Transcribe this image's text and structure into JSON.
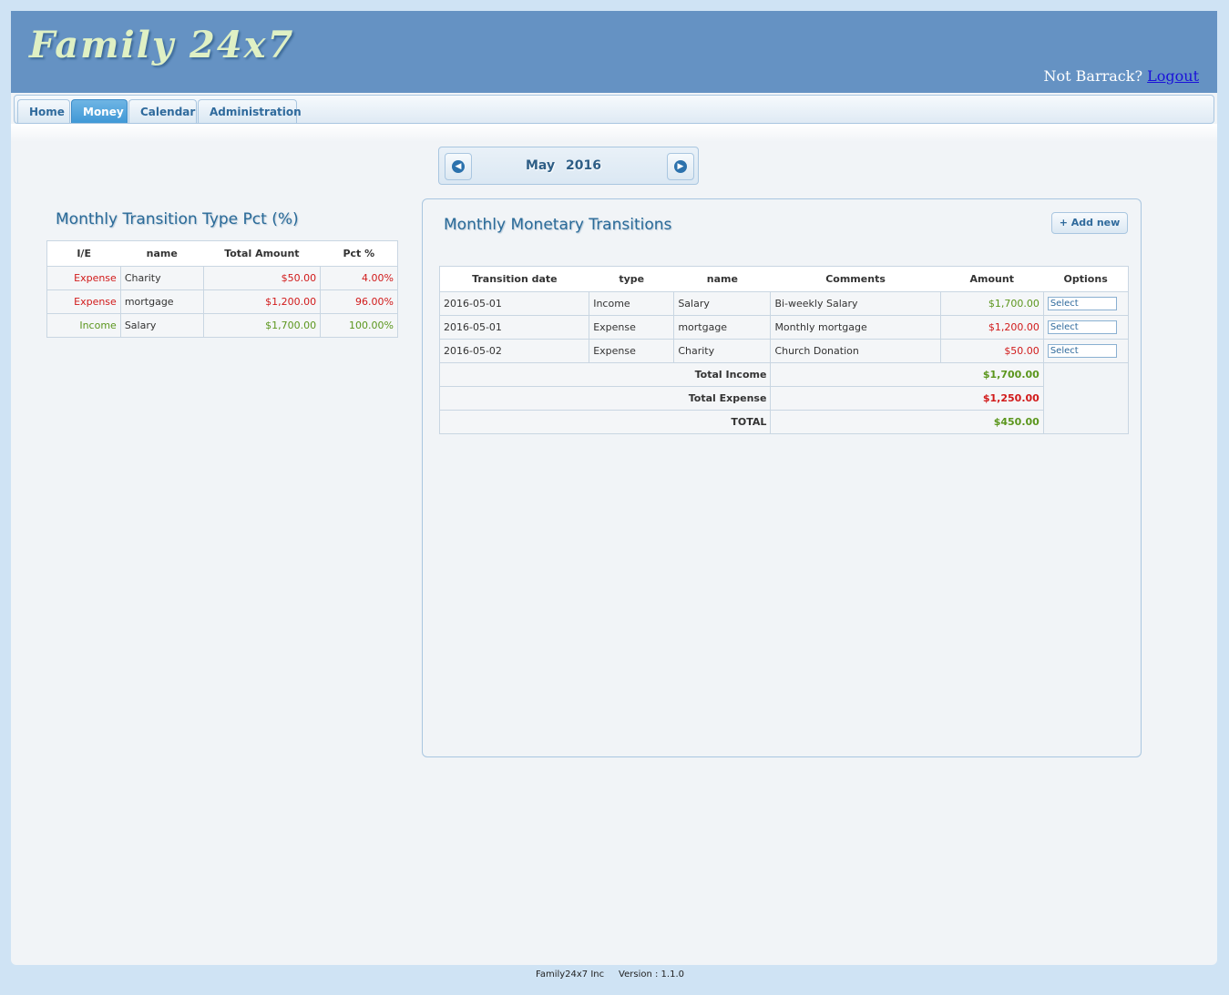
{
  "header": {
    "logo": "Family 24x7",
    "user_prompt": "Not Barrack?",
    "logout": "Logout"
  },
  "tabs": [
    {
      "label": "Home"
    },
    {
      "label": "Money"
    },
    {
      "label": "Calendar"
    },
    {
      "label": "Administration"
    }
  ],
  "month_nav": {
    "month": "May",
    "year": "2016",
    "prev_icon": "chevron-left-icon",
    "next_icon": "chevron-right-icon"
  },
  "pct_panel": {
    "title": "Monthly Transition Type Pct (%)",
    "headers": [
      "I/E",
      "name",
      "Total Amount",
      "Pct %"
    ],
    "rows": [
      {
        "ie": "Expense",
        "name": "Charity",
        "amount": "$50.00",
        "pct": "4.00%"
      },
      {
        "ie": "Expense",
        "name": "mortgage",
        "amount": "$1,200.00",
        "pct": "96.00%"
      },
      {
        "ie": "Income",
        "name": "Salary",
        "amount": "$1,700.00",
        "pct": "100.00%"
      }
    ]
  },
  "trans_panel": {
    "title": "Monthly Monetary Transitions",
    "add_button": "+ Add new",
    "headers": [
      "Transition date",
      "type",
      "name",
      "Comments",
      "Amount",
      "Options"
    ],
    "rows": [
      {
        "date": "2016-05-01",
        "type": "Income",
        "name": "Salary",
        "comments": "Bi-weekly Salary",
        "amount": "$1,700.00",
        "option": "Select"
      },
      {
        "date": "2016-05-01",
        "type": "Expense",
        "name": "mortgage",
        "comments": "Monthly mortgage",
        "amount": "$1,200.00",
        "option": "Select"
      },
      {
        "date": "2016-05-02",
        "type": "Expense",
        "name": "Charity",
        "comments": "Church Donation",
        "amount": "$50.00",
        "option": "Select"
      }
    ],
    "totals": {
      "income_label": "Total Income",
      "income_value": "$1,700.00",
      "expense_label": "Total Expense",
      "expense_value": "$1,250.00",
      "total_label": "TOTAL",
      "total_value": "$450.00"
    }
  },
  "footer": {
    "company": "Family24x7 Inc",
    "version": "Version : 1.1.0"
  },
  "colors": {
    "header_bg": "#6592c3",
    "expense": "#d11a1a",
    "income": "#5b961d",
    "accent": "#3f98d6"
  }
}
